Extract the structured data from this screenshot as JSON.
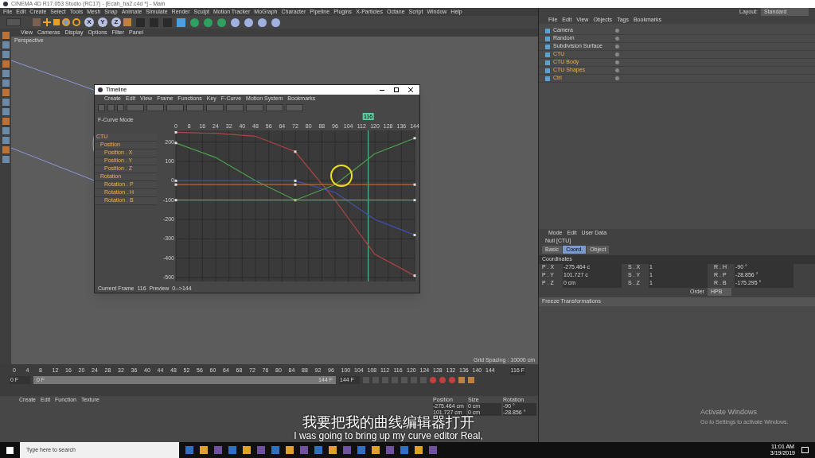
{
  "app_title": "CINEMA 4D R17.053 Studio (RC17) - [Ecah_ha2.c4d *] - Main",
  "menu": [
    "File",
    "Edit",
    "Create",
    "Select",
    "Tools",
    "Mesh",
    "Snap",
    "Animate",
    "Simulate",
    "Render",
    "Sculpt",
    "Motion Tracker",
    "MoGraph",
    "Character",
    "Pipeline",
    "Plugins",
    "X-Particles",
    "Octane",
    "Script",
    "Window",
    "Help"
  ],
  "toolbar_axes": [
    "X",
    "Y",
    "Z"
  ],
  "viewport": {
    "menu": [
      "View",
      "Cameras",
      "Display",
      "Options",
      "Filter",
      "Panel"
    ],
    "label": "Perspective",
    "grid_spacing": "Grid Spacing : 10000 cm"
  },
  "timeline_window": {
    "title": "Timeline",
    "menu": [
      "Create",
      "Edit",
      "View",
      "Frame",
      "Functions",
      "Key",
      "F-Curve",
      "Motion System",
      "Bookmarks"
    ],
    "mode": "F-Curve Mode",
    "tracks": [
      {
        "label": "CTU",
        "children": [
          {
            "label": "Position",
            "children": [
              {
                "label": "Position . X"
              },
              {
                "label": "Position . Y"
              },
              {
                "label": "Position . Z"
              }
            ]
          },
          {
            "label": "Rotation",
            "children": [
              {
                "label": "Rotation . P"
              },
              {
                "label": "Rotation . H"
              },
              {
                "label": "Rotation . B"
              }
            ]
          }
        ]
      }
    ],
    "chart_data": {
      "type": "line",
      "x": [
        0,
        24,
        48,
        72,
        96,
        120,
        144
      ],
      "series": [
        {
          "color": "#b04444",
          "values": [
            250,
            245,
            230,
            150,
            -100,
            -380,
            -490
          ]
        },
        {
          "color": "#4fa04f",
          "values": [
            195,
            120,
            0,
            -100,
            -20,
            140,
            220
          ]
        },
        {
          "color": "#4450b0",
          "values": [
            0,
            0,
            0,
            0,
            -60,
            -200,
            -280
          ]
        },
        {
          "color": "#b86a30",
          "values": [
            -20,
            -20,
            -20,
            -20,
            -20,
            -20,
            -20
          ]
        },
        {
          "color": "#48b048",
          "values": [
            -100,
            -100,
            -100,
            -100,
            -100,
            -100,
            -100
          ]
        }
      ],
      "grid": true,
      "ref_lines": [
        {
          "axis": "x",
          "value": 116,
          "label": "116",
          "color": "#5fc9a0"
        }
      ],
      "xlim": [
        0,
        144
      ],
      "ylim": [
        -520,
        260
      ],
      "xticks": [
        0,
        8,
        16,
        24,
        32,
        40,
        48,
        56,
        64,
        72,
        80,
        88,
        96,
        104,
        112,
        120,
        128,
        136,
        144
      ],
      "yticks": [
        200,
        100,
        0,
        -100,
        -200,
        -300,
        -400,
        -500
      ]
    },
    "status": "Current Frame  116  Preview  0-->144"
  },
  "layout": {
    "label": "Layout:",
    "value": "Standard"
  },
  "object_manager": {
    "menu": [
      "File",
      "Edit",
      "View",
      "Objects",
      "Tags",
      "Bookmarks"
    ],
    "objects": [
      {
        "name": "Camera",
        "highlighted": false
      },
      {
        "name": "Random",
        "highlighted": false
      },
      {
        "name": "Subdivision Surface",
        "highlighted": false
      },
      {
        "name": "CTU",
        "highlighted": true
      },
      {
        "name": "CTU Body",
        "highlighted": true
      },
      {
        "name": "CTU Shapes",
        "highlighted": true
      },
      {
        "name": "Ctrl",
        "highlighted": true
      }
    ]
  },
  "attributes": {
    "menu": [
      "Mode",
      "Edit",
      "User Data"
    ],
    "object": "Null [CTU]",
    "tabs": [
      {
        "label": "Basic",
        "selected": false
      },
      {
        "label": "Coord.",
        "selected": true
      },
      {
        "label": "Object",
        "selected": false
      }
    ],
    "section": "Coordinates",
    "rows": [
      [
        {
          "label": "P . X",
          "value": "-275.464 c"
        },
        {
          "label": "S . X",
          "value": "1"
        },
        {
          "label": "R . H",
          "value": "-90 °"
        }
      ],
      [
        {
          "label": "P . Y",
          "value": "101.727 c"
        },
        {
          "label": "S . Y",
          "value": "1"
        },
        {
          "label": "R . P",
          "value": "-28.856 °"
        }
      ],
      [
        {
          "label": "P . Z",
          "value": "0 cm"
        },
        {
          "label": "S . Z",
          "value": "1"
        },
        {
          "label": "R . B",
          "value": "-175.295 °"
        }
      ]
    ],
    "order_label": "Order",
    "order_value": "HPB",
    "freeze": "Freeze Transformations"
  },
  "timeline": {
    "level": 1,
    "ticks": [
      "0",
      "4",
      "8",
      "12",
      "16",
      "20",
      "24",
      "28",
      "32",
      "36",
      "40",
      "44",
      "48",
      "52",
      "56",
      "60",
      "64",
      "68",
      "72",
      "76",
      "80",
      "84",
      "88",
      "92",
      "96",
      "100",
      "104",
      "108",
      "112",
      "116",
      "120",
      "124",
      "128",
      "132",
      "136",
      "140",
      "144"
    ],
    "current": "116 F",
    "start": "0 F",
    "range_start": "0 F",
    "range_end": "144 F",
    "end": "144 F"
  },
  "material_menu": [
    "Create",
    "Edit",
    "Function",
    "Texture"
  ],
  "coordinates": {
    "headers": [
      "Position",
      "Size",
      "Rotation"
    ],
    "rows": [
      [
        "-275.464 cm",
        "0 cm",
        "-90 °"
      ],
      [
        "101.727 cm",
        "0 cm",
        "-28.856 °"
      ]
    ]
  },
  "subtitles": [
    "我要把我的曲线编辑器打开",
    "I was going to bring up my curve editor Real,"
  ],
  "activation": [
    "Activate Windows",
    "Go to Settings to activate Windows."
  ],
  "taskbar": {
    "search": "Type here to search",
    "time": "11:01 AM",
    "date": "3/19/2019"
  }
}
